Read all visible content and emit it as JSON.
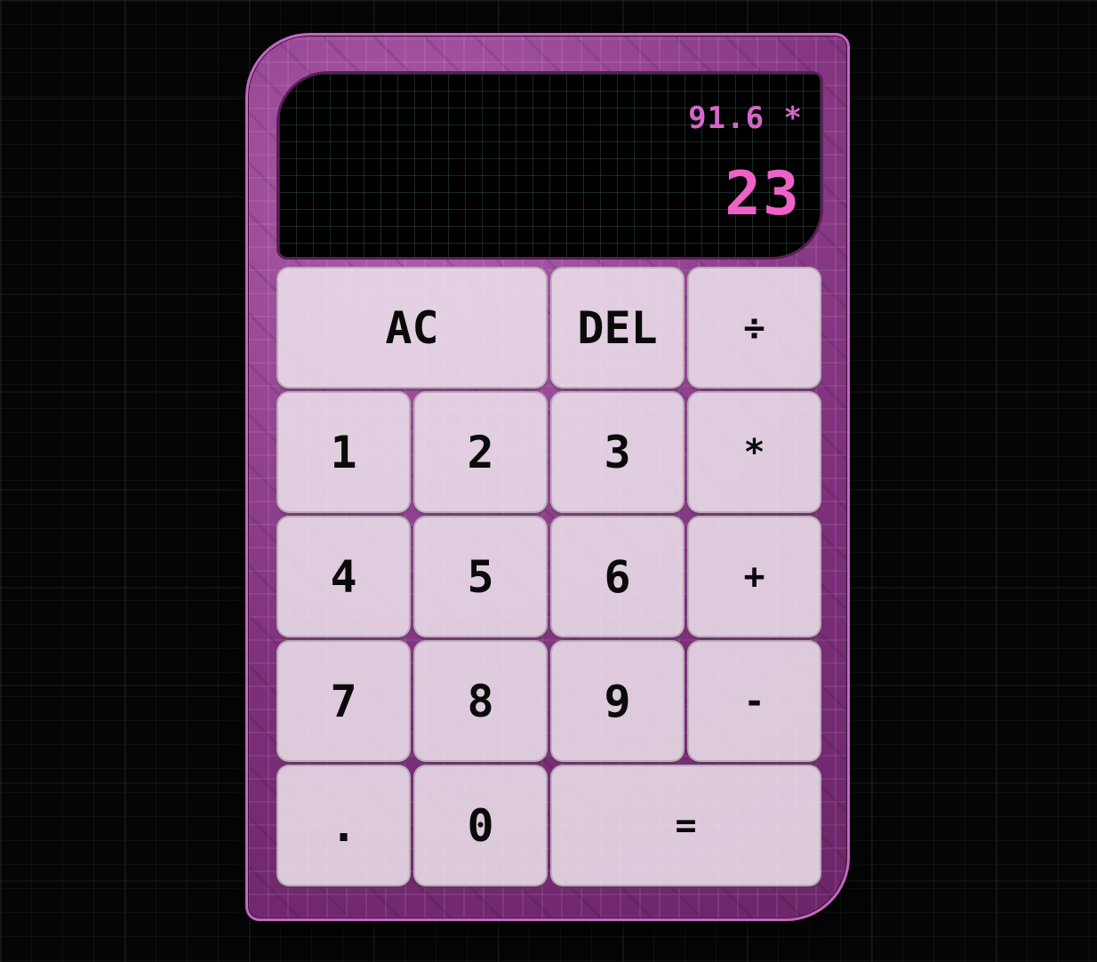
{
  "display": {
    "previous_operand": "91.6 *",
    "current_operand": "23"
  },
  "keys": {
    "all_clear": "AC",
    "delete": "DEL",
    "divide": "÷",
    "one": "1",
    "two": "2",
    "three": "3",
    "multiply": "*",
    "four": "4",
    "five": "5",
    "six": "6",
    "add": "+",
    "seven": "7",
    "eight": "8",
    "nine": "9",
    "subtract": "-",
    "decimal": ".",
    "zero": "0",
    "equals": "="
  },
  "colors": {
    "accent": "#ee62c8",
    "case": "#8a3a86",
    "key": "#eee4ec"
  }
}
